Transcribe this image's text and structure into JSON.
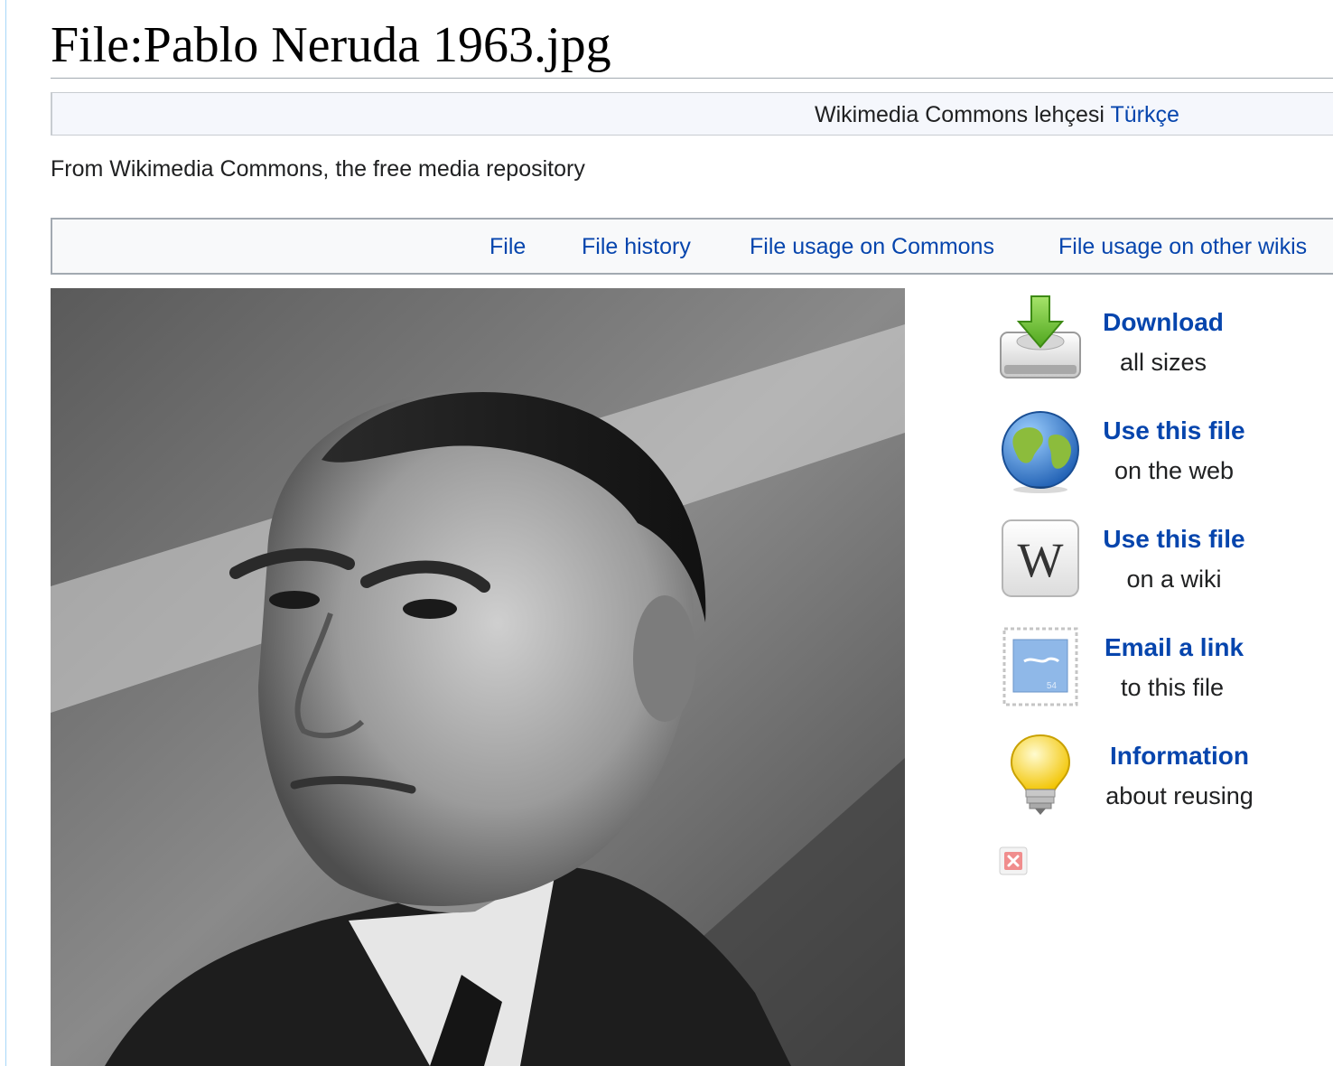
{
  "page": {
    "title": "File:Pablo Neruda 1963.jpg",
    "tagline": "From Wikimedia Commons, the free media repository"
  },
  "language_bar": {
    "text": "Wikimedia Commons lehçesi",
    "language_link": "Türkçe"
  },
  "tabs": [
    {
      "label": "File"
    },
    {
      "label": "File history"
    },
    {
      "label": "File usage on Commons"
    },
    {
      "label": "File usage on other wikis"
    }
  ],
  "sidebar": {
    "items": [
      {
        "link": "Download",
        "sub": "all sizes",
        "icon": "download-icon"
      },
      {
        "link": "Use this file",
        "sub": "on the web",
        "icon": "globe-icon"
      },
      {
        "link": "Use this file",
        "sub": "on a wiki",
        "icon": "wikipedia-w-icon"
      },
      {
        "link": "Email a link",
        "sub": "to this file",
        "icon": "stamp-envelope-icon"
      },
      {
        "link": "Information",
        "sub": "about reusing",
        "icon": "lightbulb-icon"
      }
    ],
    "close_icon": "close-icon"
  },
  "colors": {
    "link": "#0645ad",
    "text": "#202122",
    "lang_bar_bg": "#f5f7fc",
    "tab_bar_bg": "#f8f9fa",
    "border": "#a2a9b1"
  }
}
